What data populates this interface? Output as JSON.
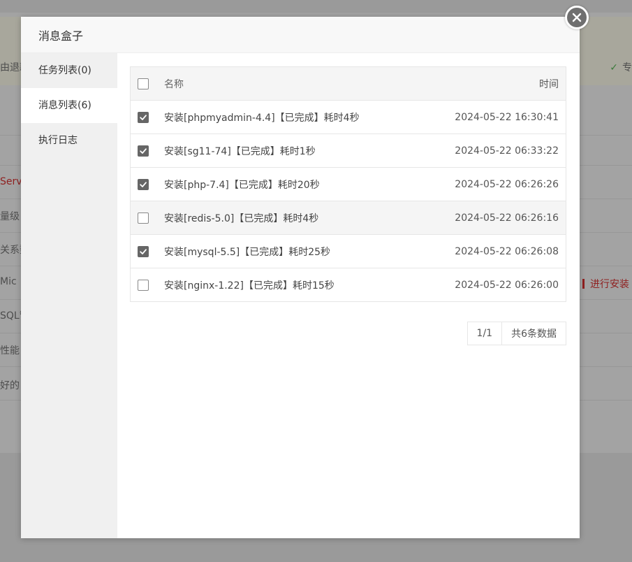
{
  "background": {
    "notice_left": "由退款",
    "notice_right": "专",
    "rows": [
      "Serve",
      "量级",
      "关系数",
      "Mic",
      "SQL管",
      "性能",
      "好的"
    ],
    "install_label": "进行安装"
  },
  "modal": {
    "title": "消息盒子",
    "sidebar": [
      {
        "label": "任务列表(0)"
      },
      {
        "label": "消息列表(6)",
        "active": true
      },
      {
        "label": "执行日志"
      }
    ],
    "table": {
      "headers": {
        "name": "名称",
        "time": "时间"
      },
      "rows": [
        {
          "name": "安装[phpmyadmin-4.4]【已完成】耗时4秒",
          "time": "2024-05-22 16:30:41",
          "checked": true
        },
        {
          "name": "安装[sg11-74]【已完成】耗时1秒",
          "time": "2024-05-22 06:33:22",
          "checked": true
        },
        {
          "name": "安装[php-7.4]【已完成】耗时20秒",
          "time": "2024-05-22 06:26:26",
          "checked": true
        },
        {
          "name": "安装[redis-5.0]【已完成】耗时4秒",
          "time": "2024-05-22 06:26:16",
          "checked": false
        },
        {
          "name": "安装[mysql-5.5]【已完成】耗时25秒",
          "time": "2024-05-22 06:26:08",
          "checked": true
        },
        {
          "name": "安装[nginx-1.22]【已完成】耗时15秒",
          "time": "2024-05-22 06:26:00",
          "checked": false
        }
      ]
    },
    "pager": {
      "page": "1/1",
      "total": "共6条数据"
    }
  }
}
